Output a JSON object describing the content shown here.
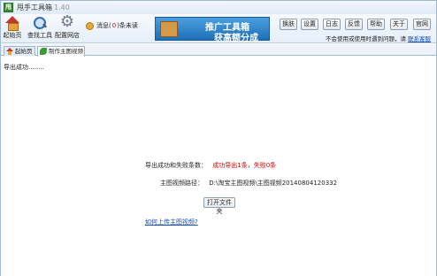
{
  "window": {
    "title": "甩手工具箱",
    "version": "1.40"
  },
  "toolbar": {
    "items": [
      {
        "label": "起始页",
        "icon": "home-icon"
      },
      {
        "label": "查找工具",
        "icon": "search-icon"
      },
      {
        "label": "配置网店",
        "icon": "gear-icon"
      }
    ],
    "messages": {
      "prefix": "消息(",
      "count": "0",
      "suffix": ")条未读"
    },
    "banner": {
      "line1": "推广工具箱",
      "line2": "获高额分成"
    },
    "buttons": [
      "换肤",
      "设置",
      "日志",
      "反馈",
      "帮助",
      "关于",
      "官网"
    ],
    "hint": "不会使用或使用时遇到问题，请",
    "hint_link": "联系客服"
  },
  "tabs": [
    {
      "label": "起始页",
      "icon": "home-icon",
      "active": false
    },
    {
      "label": "制作主图视频",
      "icon": "leaf-icon",
      "active": true
    }
  ],
  "main": {
    "status": "导出成功........",
    "result_label": "导出成功和失败条数：",
    "result_value": "成功导出1条，失败0条",
    "path_label": "主图视频路径：",
    "path_value": "D:\\淘宝主图视频\\主图视频20140804120332",
    "open_folder_button": "打开文件夹",
    "howto_link": "如何上传主图视频?"
  }
}
